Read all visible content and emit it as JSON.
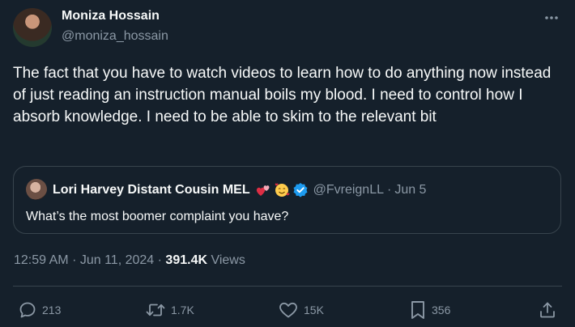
{
  "author": {
    "name": "Moniza Hossain",
    "handle": "@moniza_hossain"
  },
  "tweet": {
    "text": "The fact that you have to watch videos to learn how to do anything now instead of just reading an instruction manual boils my blood. I need to control how I absorb knowledge. I need to be able to skim to the relevant bit"
  },
  "quote": {
    "name": "Lori Harvey Distant Cousin MEL",
    "handle": "@FvreignLL",
    "separator": "·",
    "date": "Jun 5",
    "text": "What’s the most boomer complaint you have?"
  },
  "meta": {
    "time": "12:59 AM",
    "date": "Jun 11, 2024",
    "separator": "·",
    "views_count": "391.4K",
    "views_label": "Views"
  },
  "actions": {
    "replies": "213",
    "reposts": "1.7K",
    "likes": "15K",
    "bookmarks": "356"
  },
  "colors": {
    "background": "#15202b",
    "text_primary": "#f7f9f9",
    "text_secondary": "#8b98a5",
    "border": "#38444d",
    "verified_badge": "#1d9bf0"
  },
  "icons": {
    "more": "more-dots-icon",
    "reply": "reply-icon",
    "repost": "repost-icon",
    "like": "heart-icon",
    "bookmark": "bookmark-icon",
    "share": "share-icon",
    "verified": "verified-badge-icon"
  }
}
